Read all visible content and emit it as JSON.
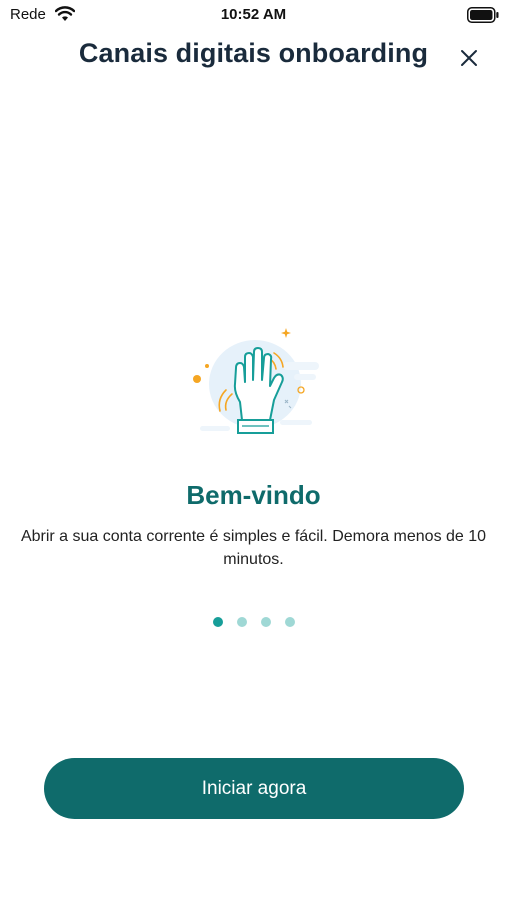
{
  "status_bar": {
    "carrier": "Rede",
    "time": "10:52 AM",
    "icons": [
      "wifi-icon",
      "battery-icon"
    ]
  },
  "header": {
    "title": "Canais digitais onboarding",
    "close_icon": "close-icon"
  },
  "slide": {
    "illustration": "waving-hand-icon",
    "title": "Bem-vindo",
    "text": "Abrir a sua conta corrente é simples e fácil. Demora menos de 10 minutos."
  },
  "pager": {
    "total": 4,
    "active_index": 0
  },
  "actions": {
    "start_label": "Iniciar agora"
  },
  "colors": {
    "primary": "#0f6b6b",
    "dot_active": "#179e99",
    "dot_inactive": "#9fd8d5",
    "accent_orange": "#f5a623"
  }
}
